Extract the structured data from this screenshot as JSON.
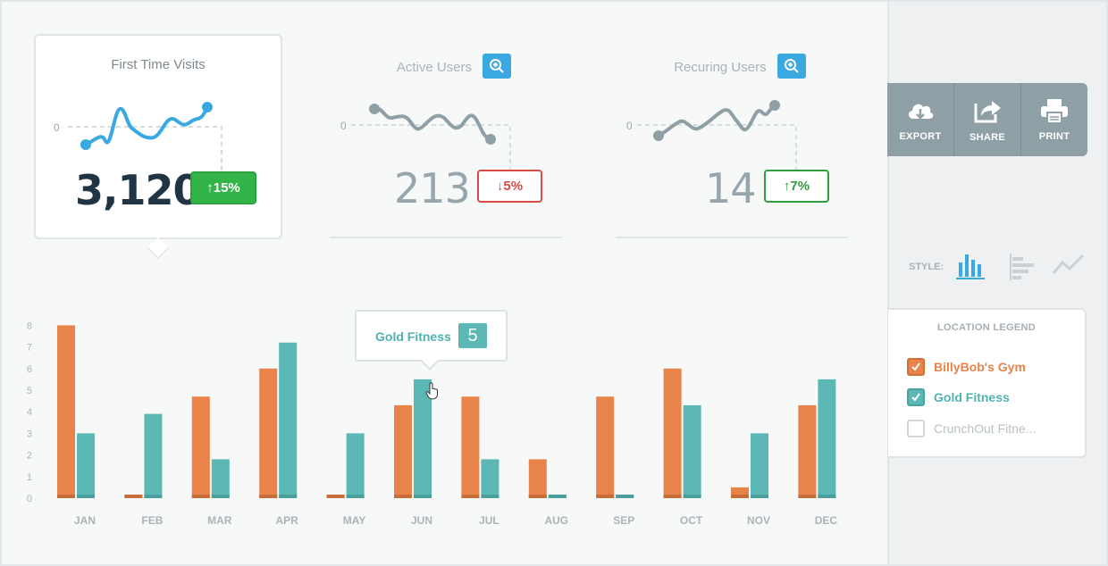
{
  "cards": [
    {
      "title": "First Time Visits",
      "value": "3,120",
      "change": "15%",
      "direction": "up",
      "zero": "0"
    },
    {
      "title": "Active Users",
      "value": "213",
      "change": "5%",
      "direction": "down",
      "zero": "0"
    },
    {
      "title": "Recuring Users",
      "value": "14",
      "change": "7%",
      "direction": "up",
      "zero": "0"
    }
  ],
  "toolbar": {
    "export": "EXPORT",
    "share": "SHARE",
    "print": "PRINT"
  },
  "style": {
    "label": "STYLE:",
    "selected": "vertical-bar"
  },
  "legend": {
    "title": "LOCATION LEGEND",
    "items": [
      {
        "label": "BillyBob's Gym",
        "checked": true,
        "color": "#e8834a"
      },
      {
        "label": "Gold Fitness",
        "checked": true,
        "color": "#5cb8b5"
      },
      {
        "label": "CrunchOut Fitne...",
        "checked": false,
        "color": "#b8c2c6"
      }
    ]
  },
  "tooltip": {
    "label": "Gold Fitness",
    "value": "5"
  },
  "chart_data": {
    "type": "bar",
    "categories": [
      "JAN",
      "FEB",
      "MAR",
      "APR",
      "MAY",
      "JUN",
      "JUL",
      "AUG",
      "SEP",
      "OCT",
      "NOV",
      "DEC"
    ],
    "y_ticks": [
      "0",
      "1",
      "2",
      "3",
      "4",
      "5",
      "6",
      "7",
      "8"
    ],
    "ylim": [
      0,
      8
    ],
    "series": [
      {
        "name": "BillyBob's Gym",
        "color": "#e8834a",
        "values": [
          8,
          0,
          4.7,
          6,
          0,
          4.3,
          4.7,
          1.8,
          4.7,
          6,
          0.5,
          4.3
        ]
      },
      {
        "name": "Gold Fitness",
        "color": "#5cb8b5",
        "values": [
          3,
          3.9,
          1.8,
          7.2,
          3,
          5.5,
          1.8,
          0,
          0,
          4.3,
          3,
          5.5
        ]
      }
    ]
  }
}
